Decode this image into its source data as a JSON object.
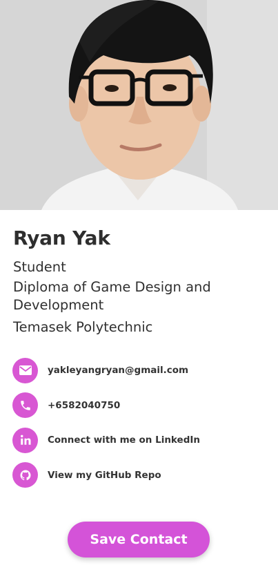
{
  "profile": {
    "name": "Ryan Yak",
    "role": "Student",
    "program": "Diploma of Game Design and Development",
    "school": "Temasek Polytechnic"
  },
  "contacts": [
    {
      "icon": "envelope-icon",
      "label": "yakleyangryan@gmail.com"
    },
    {
      "icon": "phone-icon",
      "label": "+6582040750"
    },
    {
      "icon": "linkedin-icon",
      "label": "Connect with me on LinkedIn"
    },
    {
      "icon": "github-icon",
      "label": "View my GitHub Repo"
    }
  ],
  "actions": {
    "save_label": "Save Contact"
  },
  "colors": {
    "accent": "#d857d3",
    "button": "#d453d8",
    "text": "#2e2e2e"
  }
}
